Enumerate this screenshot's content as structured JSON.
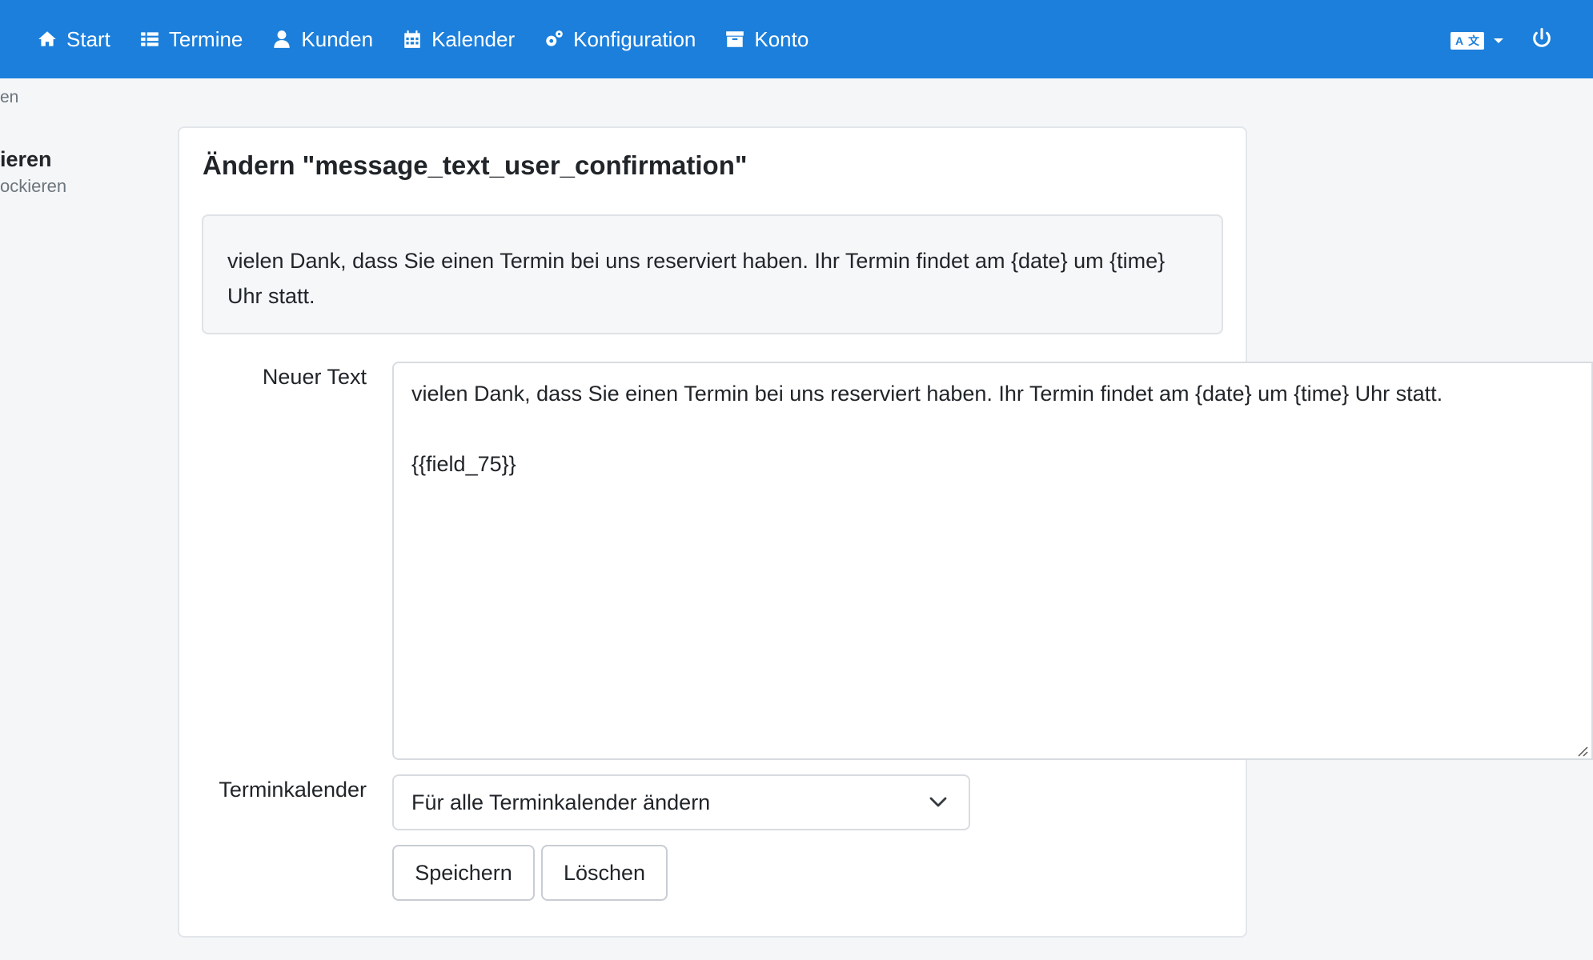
{
  "nav": {
    "items": [
      {
        "label": "Start",
        "icon": "home-icon"
      },
      {
        "label": "Termine",
        "icon": "list-icon"
      },
      {
        "label": "Kunden",
        "icon": "user-icon"
      },
      {
        "label": "Kalender",
        "icon": "calendar-icon"
      },
      {
        "label": "Konfiguration",
        "icon": "gears-icon"
      },
      {
        "label": "Konto",
        "icon": "archive-icon"
      }
    ],
    "lang_glyphs": [
      "A",
      "文"
    ]
  },
  "sidebar": {
    "crumb_fragment": "en",
    "active_fragment": "ieren",
    "sub_fragment": "ockieren"
  },
  "card": {
    "title": "Ändern \"message_text_user_confirmation\"",
    "original_text": "vielen Dank, dass Sie einen Termin bei uns reserviert haben. Ihr Termin findet am {date} um {time} Uhr statt.",
    "new_text_label": "Neuer Text",
    "new_text_value": "vielen Dank, dass Sie einen Termin bei uns reserviert haben. Ihr Termin findet am {date} um {time} Uhr statt.\n\n{{field_75}}",
    "calendar_label": "Terminkalender",
    "calendar_selected": "Für alle Terminkalender ändern",
    "save_label": "Speichern",
    "delete_label": "Löschen"
  },
  "colors": {
    "navbar": "#1c7fdb",
    "background": "#f5f6f8"
  }
}
